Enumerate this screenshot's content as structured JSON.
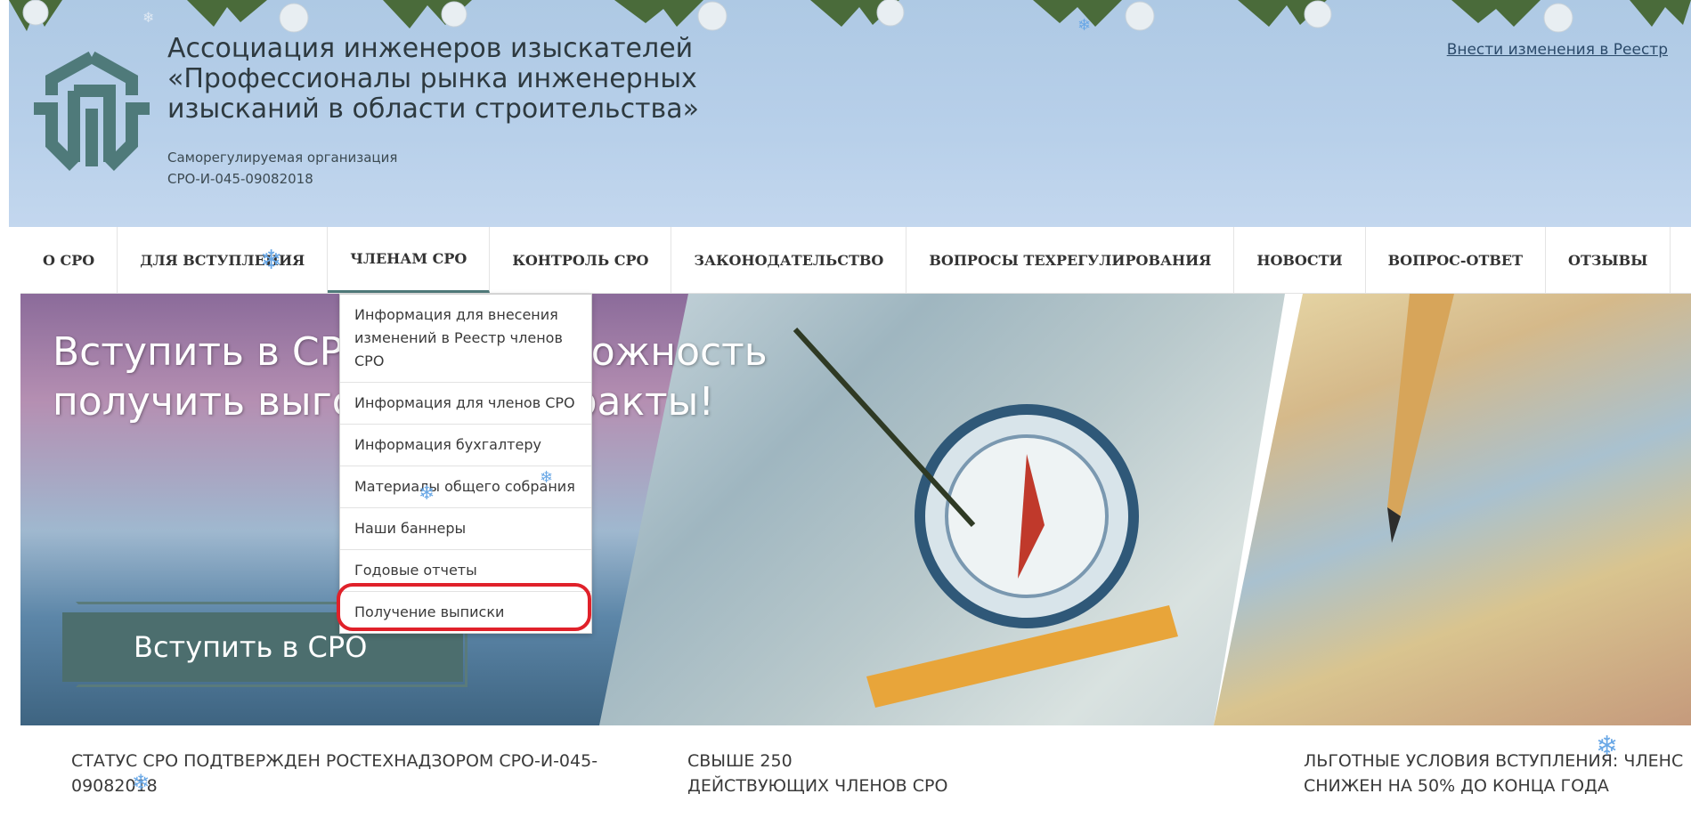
{
  "header": {
    "org_name": [
      "Ассоциация инженеров изыскателей",
      "«Профессионалы рынка инженерных",
      "изысканий в области строительства»"
    ],
    "org_type": "Саморегулируемая организация",
    "org_reg": "СРО-И-045-09082018",
    "registry_link": "Внести изменения в Реестр"
  },
  "nav": {
    "items": [
      "О СРО",
      "ДЛЯ ВСТУПЛЕНИЯ",
      "ЧЛЕНАМ СРО",
      "КОНТРОЛЬ СРО",
      "ЗАКОНОДАТЕЛЬСТВО",
      "ВОПРОСЫ ТЕХРЕГУЛИРОВАНИЯ",
      "НОВОСТИ",
      "ВОПРОС-ОТВЕТ",
      "ОТЗЫВЫ"
    ],
    "active_index": 2
  },
  "dropdown": {
    "items": [
      "Информация для внесения изменений в Реестр членов СРО",
      "Информация для членов СРО",
      "Информация бухгалтеру",
      "Материалы общего собрания",
      "Наши баннеры",
      "Годовые отчеты",
      "Получение выписки"
    ],
    "highlighted_index": 5
  },
  "hero": {
    "title_line1": "Вступить в СРО - это возможность",
    "title_line2": "получить выгодные контракты!",
    "button": "Вступить в СРО"
  },
  "stats": {
    "s1_line1": "СТАТУС СРО ПОДТВЕРЖДЕН РОСТЕХНАДЗОРОМ СРО-И-045-",
    "s1_line2": "09082018",
    "s2_line1": "СВЫШЕ 250",
    "s2_line2": "ДЕЙСТВУЮЩИХ ЧЛЕНОВ СРО",
    "s3_line1": "ЛЬГОТНЫЕ УСЛОВИЯ ВСТУПЛЕНИЯ: ЧЛЕНС",
    "s3_line2": "СНИЖЕН НА 50% ДО КОНЦА ГОДА"
  },
  "colors": {
    "header_bg": "#b8d0ea",
    "nav_active_underline": "#4f7a7a",
    "join_button": "#4c6e6e",
    "highlight_ring": "#e0212a"
  }
}
